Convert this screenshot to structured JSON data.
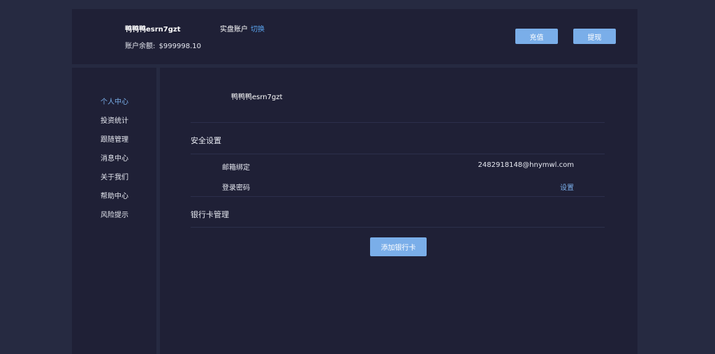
{
  "header": {
    "username": "鸭鸭鸭esrn7gzt",
    "balance_label": "账户余额:",
    "balance_value": "$999998.10",
    "account_type": "实盘账户",
    "switch_label": "切换",
    "deposit_label": "充值",
    "withdraw_label": "提现"
  },
  "sidebar": {
    "items": [
      {
        "label": "个人中心",
        "active": true
      },
      {
        "label": "投资统计",
        "active": false
      },
      {
        "label": "跟随管理",
        "active": false
      },
      {
        "label": "消息中心",
        "active": false
      },
      {
        "label": "关于我们",
        "active": false
      },
      {
        "label": "帮助中心",
        "active": false
      },
      {
        "label": "风险提示",
        "active": false
      }
    ]
  },
  "main": {
    "profile_name": "鸭鸭鸭esrn7gzt",
    "security": {
      "title": "安全设置",
      "email_label": "邮箱绑定",
      "email_value": "2482918148@hnymwl.com",
      "password_label": "登录密码",
      "password_action": "设置"
    },
    "bank": {
      "title": "银行卡管理",
      "add_card_label": "添加银行卡"
    }
  },
  "colors": {
    "background": "#262a41",
    "panel": "#1f2036",
    "accent": "#7aaee9",
    "link": "#5aa5f0"
  }
}
